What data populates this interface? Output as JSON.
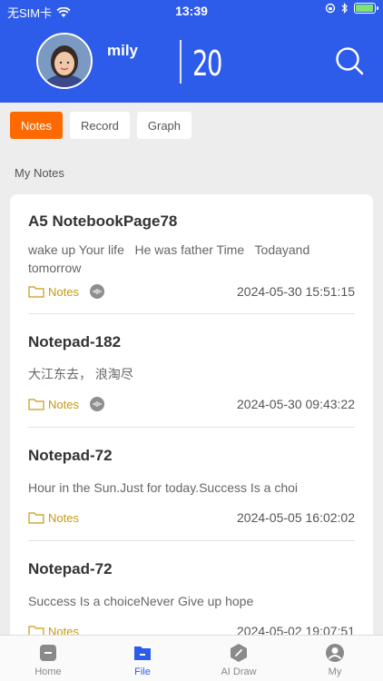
{
  "status_bar": {
    "carrier": "无SIM卡",
    "time": "13:39"
  },
  "profile": {
    "username": "mily",
    "count": "20",
    "icons": [
      "avatar",
      "search-icon"
    ]
  },
  "tabs": [
    {
      "label": "Notes",
      "active": true
    },
    {
      "label": "Record",
      "active": false
    },
    {
      "label": "Graph",
      "active": false
    }
  ],
  "section_title": "My Notes",
  "notes": [
    {
      "title": "A5 NotebookPage78",
      "body": "wake up Your life   He was father Time   Todayand tomorrow",
      "tag": "Notes",
      "has_voice": true,
      "date": "2024-05-30 15:51:15"
    },
    {
      "title": "Notepad-182",
      "body": "大江东去， 浪淘尽",
      "tag": "Notes",
      "has_voice": true,
      "date": "2024-05-30 09:43:22"
    },
    {
      "title": "Notepad-72",
      "body": "Hour in the Sun.Just for today.Success Is a choi",
      "tag": "Notes",
      "has_voice": false,
      "date": "2024-05-05 16:02:02"
    },
    {
      "title": "Notepad-72",
      "body": "Success Is a choiceNever Give up hope",
      "tag": "Notes",
      "has_voice": false,
      "date": "2024-05-02 19:07:51"
    }
  ],
  "bottom_nav": [
    {
      "label": "Home",
      "icon": "home-icon",
      "active": false
    },
    {
      "label": "File",
      "icon": "file-icon",
      "active": true
    },
    {
      "label": "AI Draw",
      "icon": "ai-draw-icon",
      "active": false
    },
    {
      "label": "My",
      "icon": "profile-icon",
      "active": false
    }
  ],
  "colors": {
    "brand_blue": "#2d5bea",
    "accent_orange": "#ff6a00",
    "tag_gold": "#c79a14"
  }
}
